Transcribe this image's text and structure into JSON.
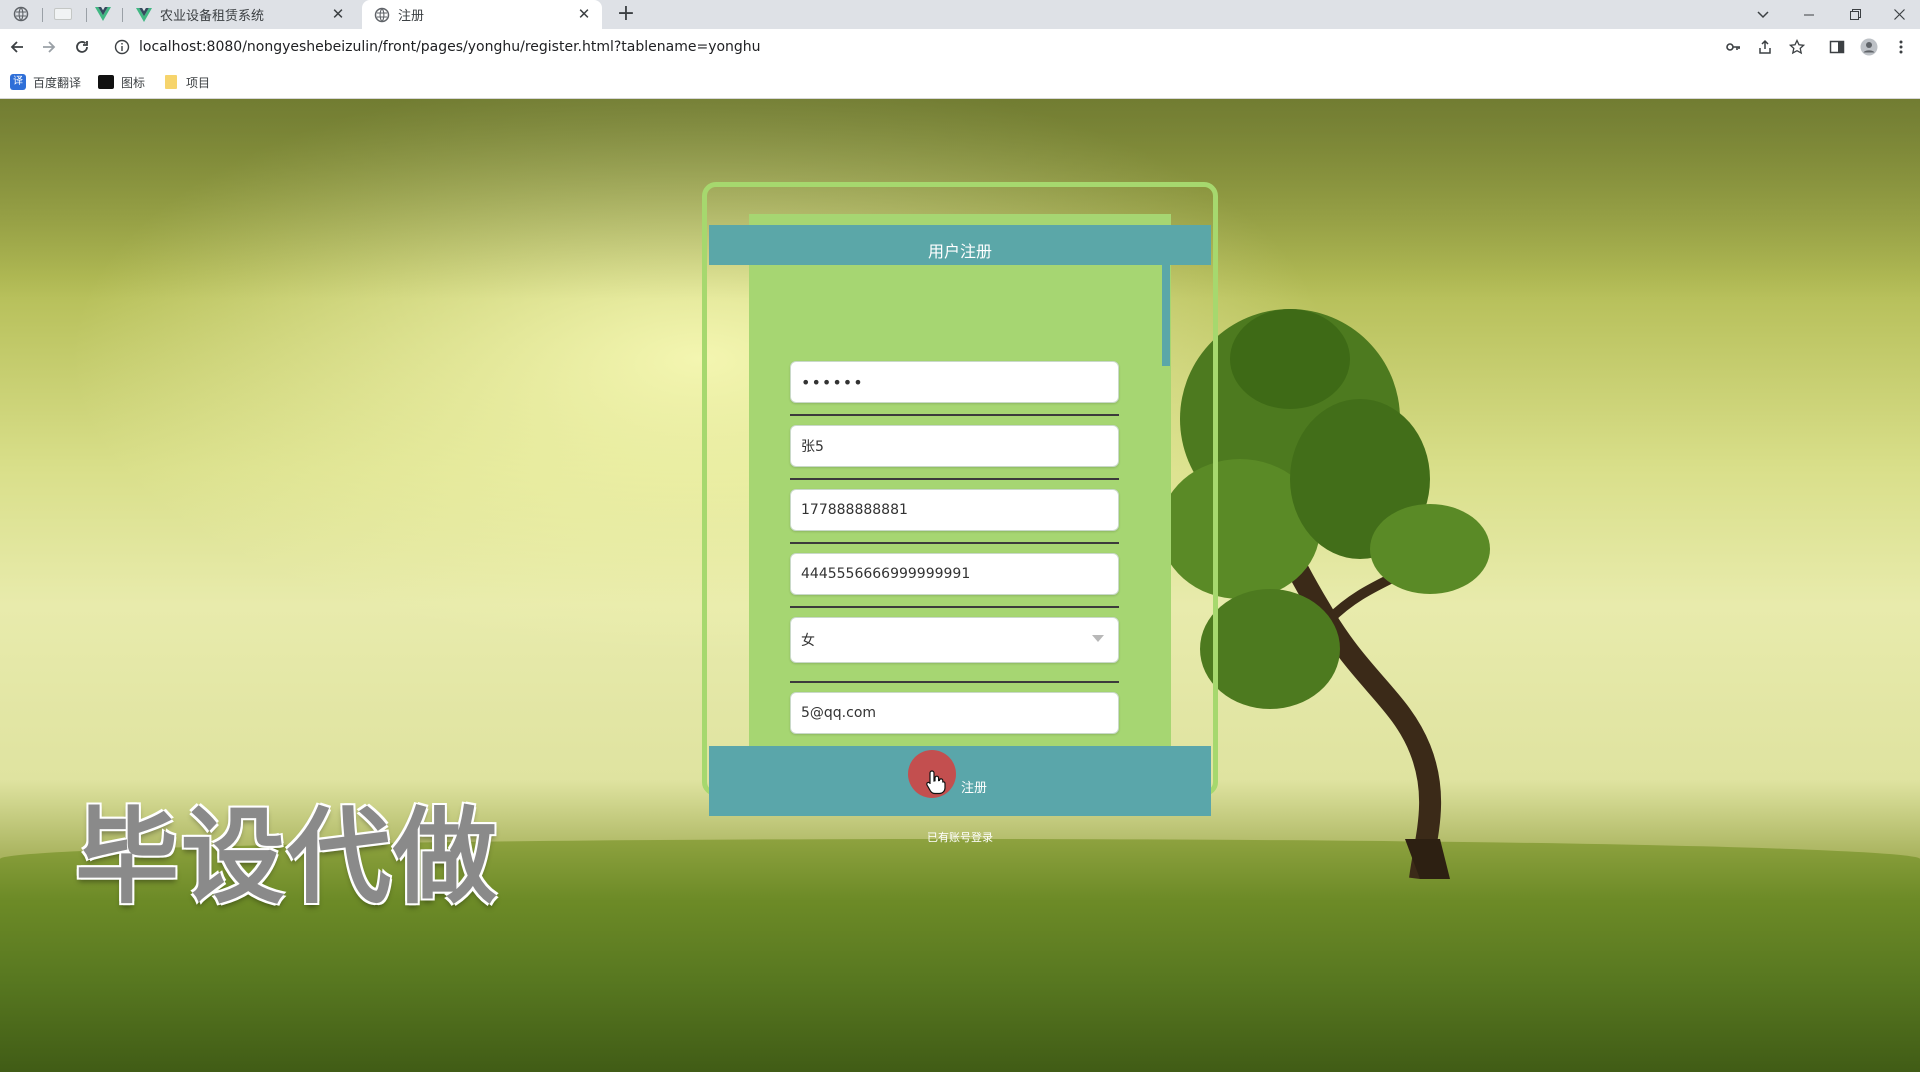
{
  "browser": {
    "tabs": [
      {
        "title": "农业设备租赁系统",
        "active": false
      },
      {
        "title": "注册",
        "active": true
      }
    ],
    "url": "localhost:8080/nongyeshebeizulin/front/pages/yonghu/register.html?tablename=yonghu",
    "bookmarks": [
      "百度翻译",
      "图标",
      "项目"
    ]
  },
  "form": {
    "title": "用户注册",
    "password_value": "••••••",
    "name_value": "张5",
    "phone_value": "177888888881",
    "idcard_value": "4445556666999999991",
    "gender_value": "女",
    "email_value": "5@qq.com",
    "submit_label": "注册",
    "login_link": "已有账号登录"
  },
  "watermark": "毕设代做",
  "colors": {
    "header": "#5ba7a8",
    "card": "#a6d672",
    "frame": "#a6d86e"
  }
}
